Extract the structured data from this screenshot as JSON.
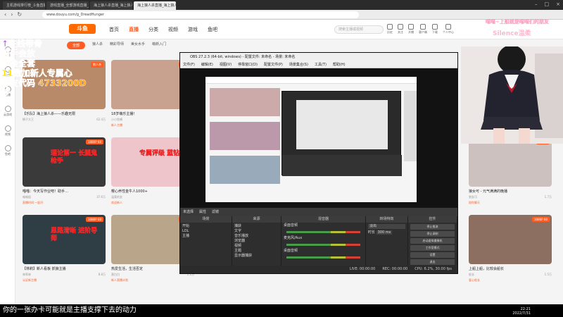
{
  "browser": {
    "tabs": [
      "主机游戏排行榜_斗鱼直播平台",
      "游戏直播_全部游戏直播_斗鱼直播",
      "海上狼人杀直播_海上狼人杀视频",
      "海上狼人杀直播_海上狼人杀"
    ],
    "url": "www.douyu.com/g_DreadHunger"
  },
  "site": {
    "logo": "斗鱼",
    "nav": [
      "首页",
      "直播",
      "分类",
      "视频",
      "游戏",
      "鱼吧"
    ],
    "active_nav": "直播",
    "search_placeholder": "搜索主播或视频",
    "header_icons": [
      "历史",
      "关注",
      "开播",
      "客户端",
      "下载",
      "个人中心"
    ],
    "subtabs": [
      "全部",
      "狼人杀",
      "精彩导师",
      "美女水手",
      "萌新入门"
    ],
    "left_nav": [
      "推荐",
      "分类",
      "直播",
      "云游戏",
      "视频",
      "鱼吧"
    ],
    "cards": [
      {
        "title": "【乐队】海上狼人杀——乐趣无限",
        "user": "狮子大王",
        "views": "62.4万",
        "tag": "",
        "badge": "狼人杀"
      },
      {
        "title": "18岁萌乐主播！",
        "user": "小小鱼酱",
        "views": "9.2万",
        "tag": "新人主播",
        "badge": "1080P"
      },
      {
        "title": "",
        "user": "",
        "views": "",
        "tag": "",
        "badge": ""
      },
      {
        "title": "",
        "user": "",
        "views": "",
        "tag": "",
        "badge": ""
      },
      {
        "title": "狼人杀大佬",
        "user": "毛毛",
        "views": "3.1万",
        "tag": "",
        "badge": "1080P"
      },
      {
        "title": "喵喵：今天写作业吧！助手…",
        "user": "喵喵姐",
        "views": "37.6万",
        "tag": "直播时间:一起开",
        "badge": "1080P 60"
      },
      {
        "title": "樱心养性金牛人1000+",
        "user": "温柔的女",
        "views": "9.3万",
        "tag": "欢迎新人",
        "badge": ""
      },
      {
        "title": "",
        "user": "",
        "views": "",
        "tag": "",
        "badge": ""
      },
      {
        "title": "",
        "user": "",
        "views": "",
        "tag": "",
        "badge": ""
      },
      {
        "title": "狼女可 - 元气满满的晚播",
        "user": "狼女可",
        "views": "1.7万",
        "tag": "陪你聊天",
        "badge": "1080P"
      },
      {
        "title": "【林莉】新人看板 抓狼主播",
        "user": "林莉林",
        "views": "8.8万",
        "tag": "认证新主播",
        "badge": "1080P 60"
      },
      {
        "title": "热爱生活，生活否定",
        "user": "莫白白",
        "views": "1.1万",
        "tag": "新人直播计划",
        "badge": "1080P"
      },
      {
        "title": "",
        "user": "",
        "views": "",
        "tag": "",
        "badge": ""
      },
      {
        "title": "",
        "user": "",
        "views": "",
        "tag": "",
        "badge": ""
      },
      {
        "title": "上船上船，比较会船长",
        "user": "船长",
        "views": "1.5万",
        "tag": "爱心船长",
        "badge": "1080P 60"
      }
    ],
    "card_banners": [
      "理论第一 长腿鬼枪手",
      "专属评级 蓝钻",
      "思路清晰 进阶导师"
    ]
  },
  "obs": {
    "title": "OBS 27.2.3 (64-bit, windows) - 配置文件: 未命名 - 场景: 未命名",
    "menu": [
      "文件(F)",
      "编辑(E)",
      "视图(V)",
      "停靠窗口(D)",
      "配置文件(P)",
      "场景集合(S)",
      "工具(T)",
      "帮助(H)"
    ],
    "scene_bar": [
      "未选择",
      "属性",
      "滤镜"
    ],
    "docks": {
      "scenes": {
        "header": "场景",
        "items": [
          "开始",
          "LOL",
          "主播"
        ]
      },
      "sources": {
        "header": "来源",
        "items": [
          "捕获",
          "文字",
          "音乐播放",
          "浏览器",
          "视频",
          "主题",
          "显示器捕获"
        ]
      },
      "mixer": {
        "header": "混音器",
        "items": [
          "桌面音频",
          "麦克风/Aux",
          "桌面音频"
        ]
      },
      "transitions": {
        "header": "转场特效",
        "fade": "淡出",
        "duration_label": "时长",
        "duration": "300 ms"
      },
      "controls": {
        "header": "控件",
        "buttons": [
          "停止推流",
          "停止录制",
          "启动虚拟摄像机",
          "工作室模式",
          "设置",
          "退出"
        ]
      }
    },
    "status": {
      "live": "LIVE: 00:00:00",
      "rec": "REC: 00:00:00",
      "cpu": "CPU: 6.2%, 30.00 fps"
    }
  },
  "overlay": {
    "left_lines": [
      "↑在线带骨",
      "猫手会放",
      "不会全套",
      "11数加新人专属心",
      "好友代码 4733200D",
      "梦"
    ],
    "top_right": "喵喵~上船就是喵喵们的朋友",
    "streamer_label": "Silence温柔"
  },
  "caption": "你的一张办卡可能就是主播支撑下去的动力",
  "clock": {
    "time": "22:21",
    "date": "2022/7/31"
  },
  "colors": {
    "accent": "#ff5d23",
    "obs_bg": "#2b2b2b",
    "overlay_text": "#7b2cbf"
  }
}
